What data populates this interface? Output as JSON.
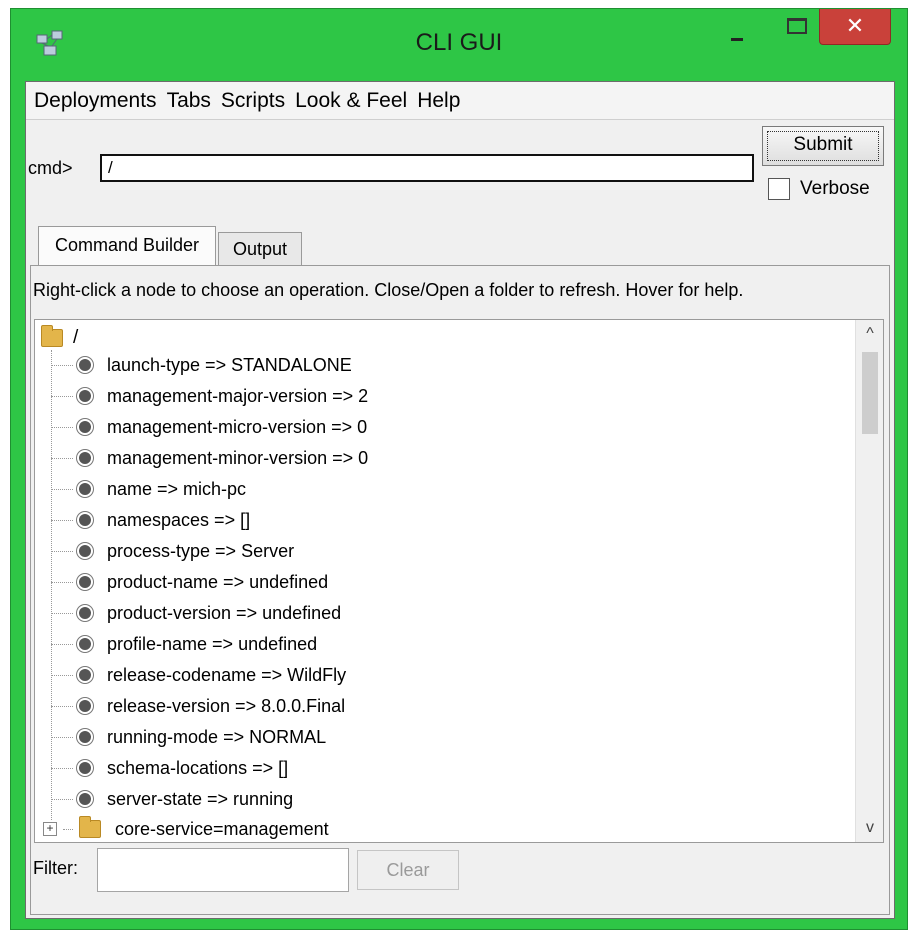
{
  "window": {
    "title": "CLI GUI",
    "close_glyph": "✕",
    "frame_color": "#2ec646"
  },
  "menu": [
    "Deployments",
    "Tabs",
    "Scripts",
    "Look & Feel",
    "Help"
  ],
  "command": {
    "label": "cmd>",
    "value": "/",
    "submit_label": "Submit",
    "verbose_label": "Verbose",
    "verbose_checked": false
  },
  "tabs": [
    {
      "label": "Command Builder",
      "active": true
    },
    {
      "label": "Output",
      "active": false
    }
  ],
  "hint": "Right-click a node to choose an operation.  Close/Open a folder to refresh.  Hover for help.",
  "tree": {
    "root_label": "/",
    "items": [
      "launch-type => STANDALONE",
      "management-major-version => 2",
      "management-micro-version => 0",
      "management-minor-version => 0",
      "name => mich-pc",
      "namespaces => []",
      "process-type => Server",
      "product-name => undefined",
      "product-version => undefined",
      "profile-name => undefined",
      "release-codename => WildFly",
      "release-version => 8.0.0.Final",
      "running-mode => NORMAL",
      "schema-locations => []",
      "server-state => running"
    ],
    "folder_item": "core-service=management"
  },
  "filter": {
    "label": "Filter:",
    "value": "",
    "clear_label": "Clear"
  },
  "icons": {
    "app": "app-icon",
    "scroll_up": "^",
    "scroll_down": "v",
    "expand": "+"
  }
}
